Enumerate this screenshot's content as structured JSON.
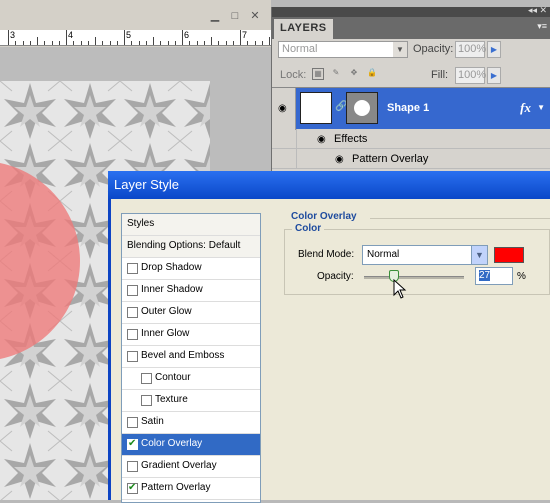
{
  "document": {
    "ruler_numbers": [
      "3",
      "4",
      "5",
      "6",
      "7",
      "8",
      "9"
    ]
  },
  "layers_panel": {
    "tab_label": "LAYERS",
    "blend_mode": "Normal",
    "opacity_label": "Opacity:",
    "opacity_value": "100%",
    "lock_label": "Lock:",
    "fill_label": "Fill:",
    "fill_value": "100%",
    "layer": {
      "name": "Shape 1",
      "fx": "fx"
    },
    "effects_label": "Effects",
    "pattern_overlay_label": "Pattern Overlay"
  },
  "dialog": {
    "title": "Layer Style",
    "styles_list": [
      {
        "label": "Styles",
        "type": "header"
      },
      {
        "label": "Blending Options: Default",
        "type": "header"
      },
      {
        "label": "Drop Shadow",
        "checked": false,
        "indent": 0
      },
      {
        "label": "Inner Shadow",
        "checked": false,
        "indent": 0
      },
      {
        "label": "Outer Glow",
        "checked": false,
        "indent": 0
      },
      {
        "label": "Inner Glow",
        "checked": false,
        "indent": 0
      },
      {
        "label": "Bevel and Emboss",
        "checked": false,
        "indent": 0
      },
      {
        "label": "Contour",
        "checked": false,
        "indent": 1
      },
      {
        "label": "Texture",
        "checked": false,
        "indent": 1
      },
      {
        "label": "Satin",
        "checked": false,
        "indent": 0
      },
      {
        "label": "Color Overlay",
        "checked": true,
        "indent": 0,
        "selected": true
      },
      {
        "label": "Gradient Overlay",
        "checked": false,
        "indent": 0
      },
      {
        "label": "Pattern Overlay",
        "checked": true,
        "indent": 0
      }
    ],
    "color_overlay": {
      "group_title": "Color Overlay",
      "fieldset_title": "Color",
      "blend_mode_label": "Blend Mode:",
      "blend_mode_value": "Normal",
      "color": "#ff0000",
      "opacity_label": "Opacity:",
      "opacity_value": "27",
      "opacity_unit": "%"
    }
  }
}
